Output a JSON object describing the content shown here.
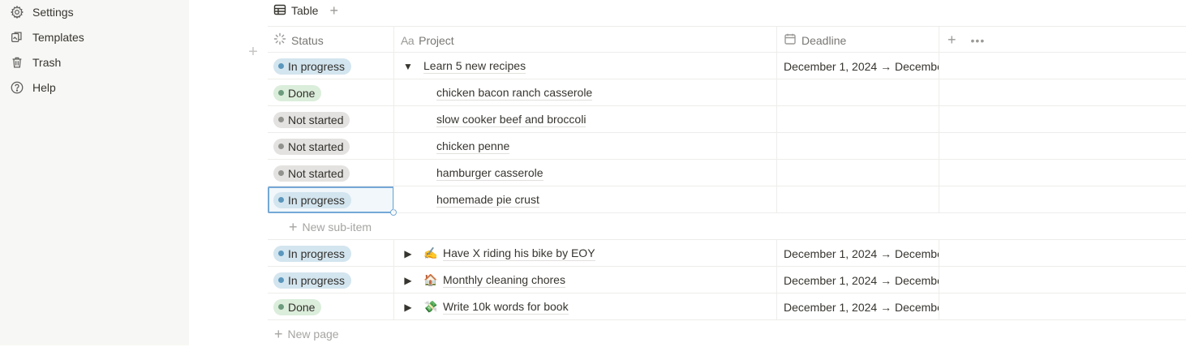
{
  "sidebar": {
    "items": [
      {
        "label": "Settings",
        "icon": "gear-icon"
      },
      {
        "label": "Templates",
        "icon": "templates-icon"
      },
      {
        "label": "Trash",
        "icon": "trash-icon"
      },
      {
        "label": "Help",
        "icon": "help-icon"
      }
    ]
  },
  "view": {
    "tab_label": "Table",
    "add_view": "+"
  },
  "columns": {
    "status": "Status",
    "project_prefix": "Aa",
    "project": "Project",
    "deadline": "Deadline"
  },
  "rows": [
    {
      "status": "In progress",
      "toggle": "▼",
      "emoji": "",
      "title": "Learn 5 new recipes",
      "deadline": "December 1, 2024 → December"
    },
    {
      "status": "Done",
      "title": "chicken bacon ranch casserole",
      "deadline": ""
    },
    {
      "status": "Not started",
      "title": "slow cooker beef and broccoli",
      "deadline": ""
    },
    {
      "status": "Not started",
      "title": "chicken penne",
      "deadline": ""
    },
    {
      "status": "Not started",
      "title": "hamburger casserole",
      "deadline": ""
    },
    {
      "status": "In progress",
      "title": "homemade pie crust",
      "deadline": ""
    },
    {
      "new_sub_item": "New sub-item"
    },
    {
      "status": "In progress",
      "toggle": "▶",
      "emoji": "✍️",
      "title": "Have X riding his bike by EOY",
      "deadline": "December 1, 2024 → December"
    },
    {
      "status": "In progress",
      "toggle": "▶",
      "emoji": "🏠",
      "title": "Monthly cleaning chores",
      "deadline": "December 1, 2024 → December"
    },
    {
      "status": "Done",
      "toggle": "▶",
      "emoji": "💸",
      "title": "Write 10k words for book",
      "deadline": "December 1, 2024 → December"
    }
  ],
  "new_page": "New page",
  "colors": {
    "in_progress_bg": "#d3e5ef",
    "done_bg": "#dbeddb",
    "not_started_bg": "#e3e2e0",
    "selection_border": "#74a8d6"
  }
}
